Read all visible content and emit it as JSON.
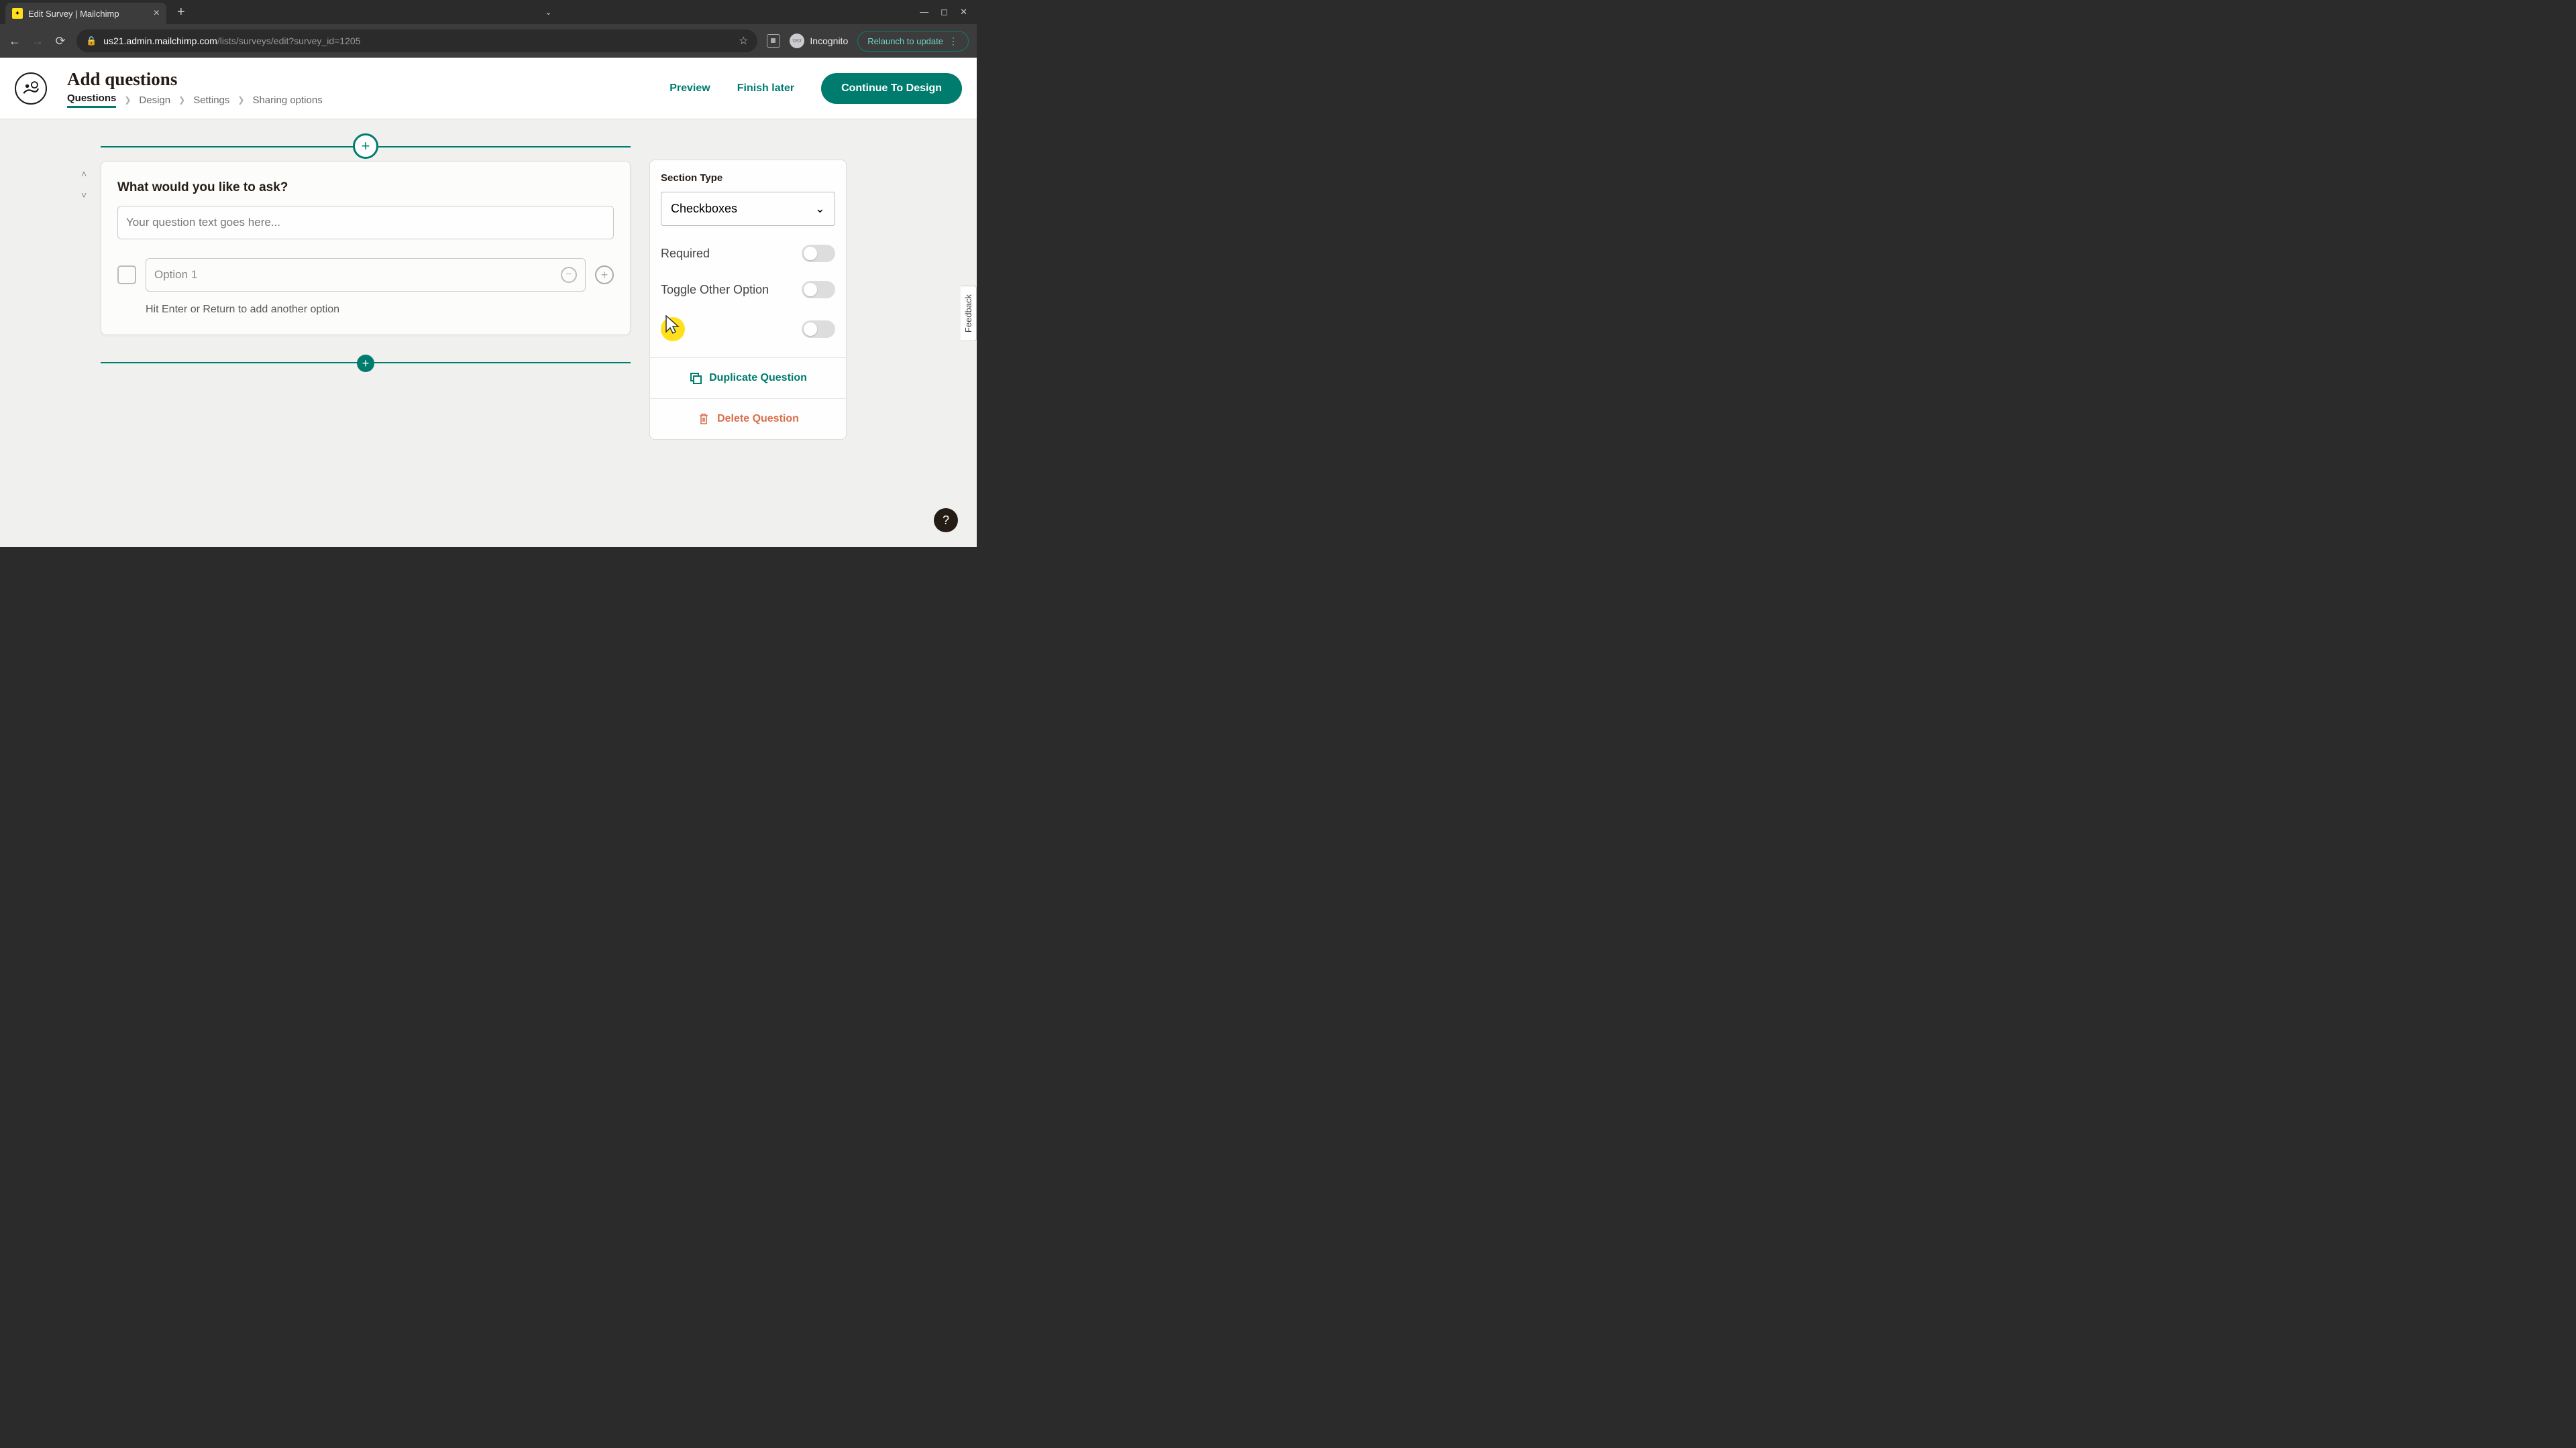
{
  "browser": {
    "tab_title": "Edit Survey | Mailchimp",
    "url_domain": "us21.admin.mailchimp.com",
    "url_path": "/lists/surveys/edit?survey_id=1205",
    "incognito_label": "Incognito",
    "relaunch_label": "Relaunch to update"
  },
  "header": {
    "title": "Add questions",
    "crumbs": [
      "Questions",
      "Design",
      "Settings",
      "Sharing options"
    ],
    "preview": "Preview",
    "finish_later": "Finish later",
    "continue": "Continue To Design"
  },
  "editor": {
    "question_label": "What would you like to ask?",
    "question_placeholder": "Your question text goes here...",
    "option_placeholder": "Option 1",
    "hint": "Hit Enter or Return to add another option"
  },
  "panel": {
    "section_type_label": "Section Type",
    "section_type_value": "Checkboxes",
    "required_label": "Required",
    "other_label": "Toggle Other Option",
    "duplicate": "Duplicate Question",
    "delete": "Delete Question"
  },
  "misc": {
    "feedback": "Feedback",
    "help": "?"
  }
}
